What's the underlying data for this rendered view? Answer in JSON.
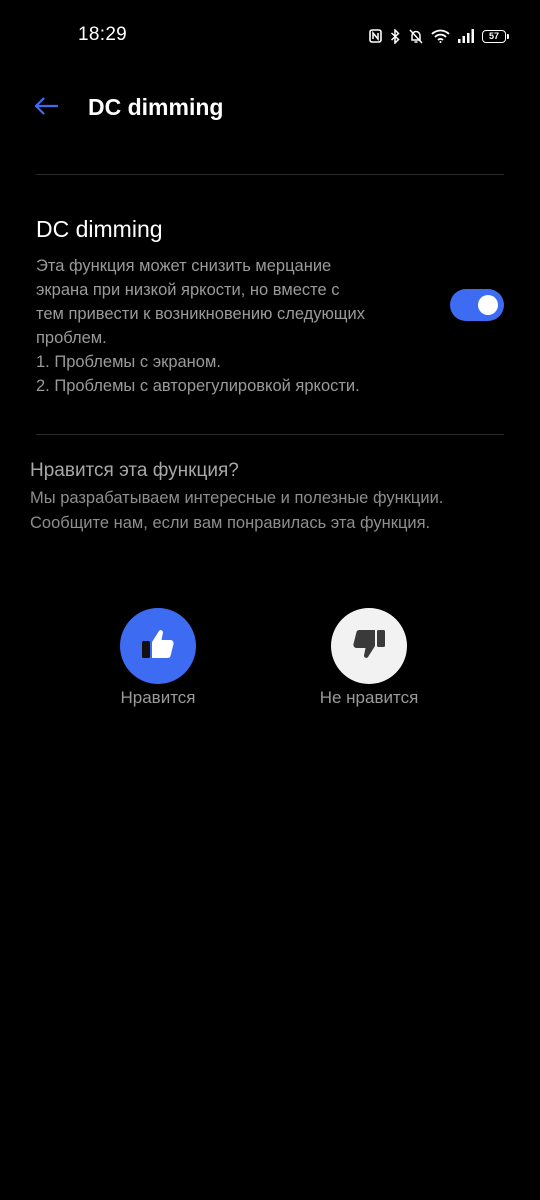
{
  "status_bar": {
    "time": "18:29",
    "icons": [
      "nfc-icon",
      "bluetooth-icon",
      "mute-bell-icon",
      "wifi-icon",
      "signal-icon",
      "battery-icon"
    ],
    "battery_level": "57"
  },
  "header": {
    "back_icon": "arrow-left-icon",
    "title": "DC dimming"
  },
  "setting": {
    "title": "DC dimming",
    "description_lines": [
      "Эта функция может снизить мерцание",
      "экрана при низкой яркости, но вместе с",
      "тем привести к возникновению следующих",
      "проблем.",
      "1. Проблемы с экраном.",
      "2. Проблемы с авторегулировкой яркости."
    ],
    "toggle_on": true
  },
  "feedback": {
    "title": "Нравится эта функция?",
    "description_lines": [
      "Мы разрабатываем интересные и полезные функции.",
      "Сообщите нам, если вам понравилась эта функция."
    ],
    "like_label": "Нравится",
    "dislike_label": "Не нравится",
    "like_icon": "thumbs-up-icon",
    "dislike_icon": "thumbs-down-icon"
  },
  "colors": {
    "background": "#000000",
    "accent": "#3d6cf2",
    "primary_text": "#ffffff",
    "secondary_text": "#9a9a9a"
  }
}
